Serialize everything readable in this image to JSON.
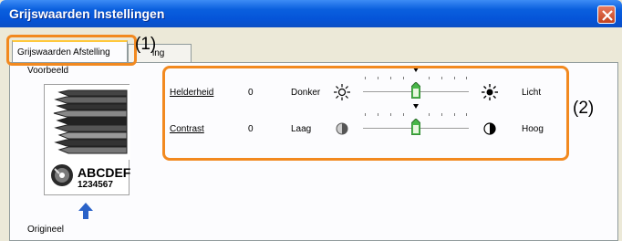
{
  "window": {
    "title": "Grijswaarden Instellingen"
  },
  "tabs": [
    {
      "label": "Grijswaarden Afstelling"
    },
    {
      "label": "ing"
    }
  ],
  "preview": {
    "label": "Voorbeeld",
    "sample_text": "ABCDEF",
    "sample_numbers": "1234567",
    "origin_label": "Origineel"
  },
  "sliders": [
    {
      "label": "Helderheid",
      "value": "0",
      "left_label": "Donker",
      "right_label": "Licht",
      "level": 0.5,
      "left_icon": "sun-dim-icon",
      "right_icon": "sun-bright-icon"
    },
    {
      "label": "Contrast",
      "value": "0",
      "left_label": "Laag",
      "right_label": "Hoog",
      "level": 0.5,
      "left_icon": "contrast-low-icon",
      "right_icon": "contrast-high-icon"
    }
  ],
  "callouts": {
    "one": "(1)",
    "two": "(2)"
  },
  "colors": {
    "highlight": "#f2891f",
    "titlebar": "#0554d8",
    "thumb": "#48b648"
  }
}
